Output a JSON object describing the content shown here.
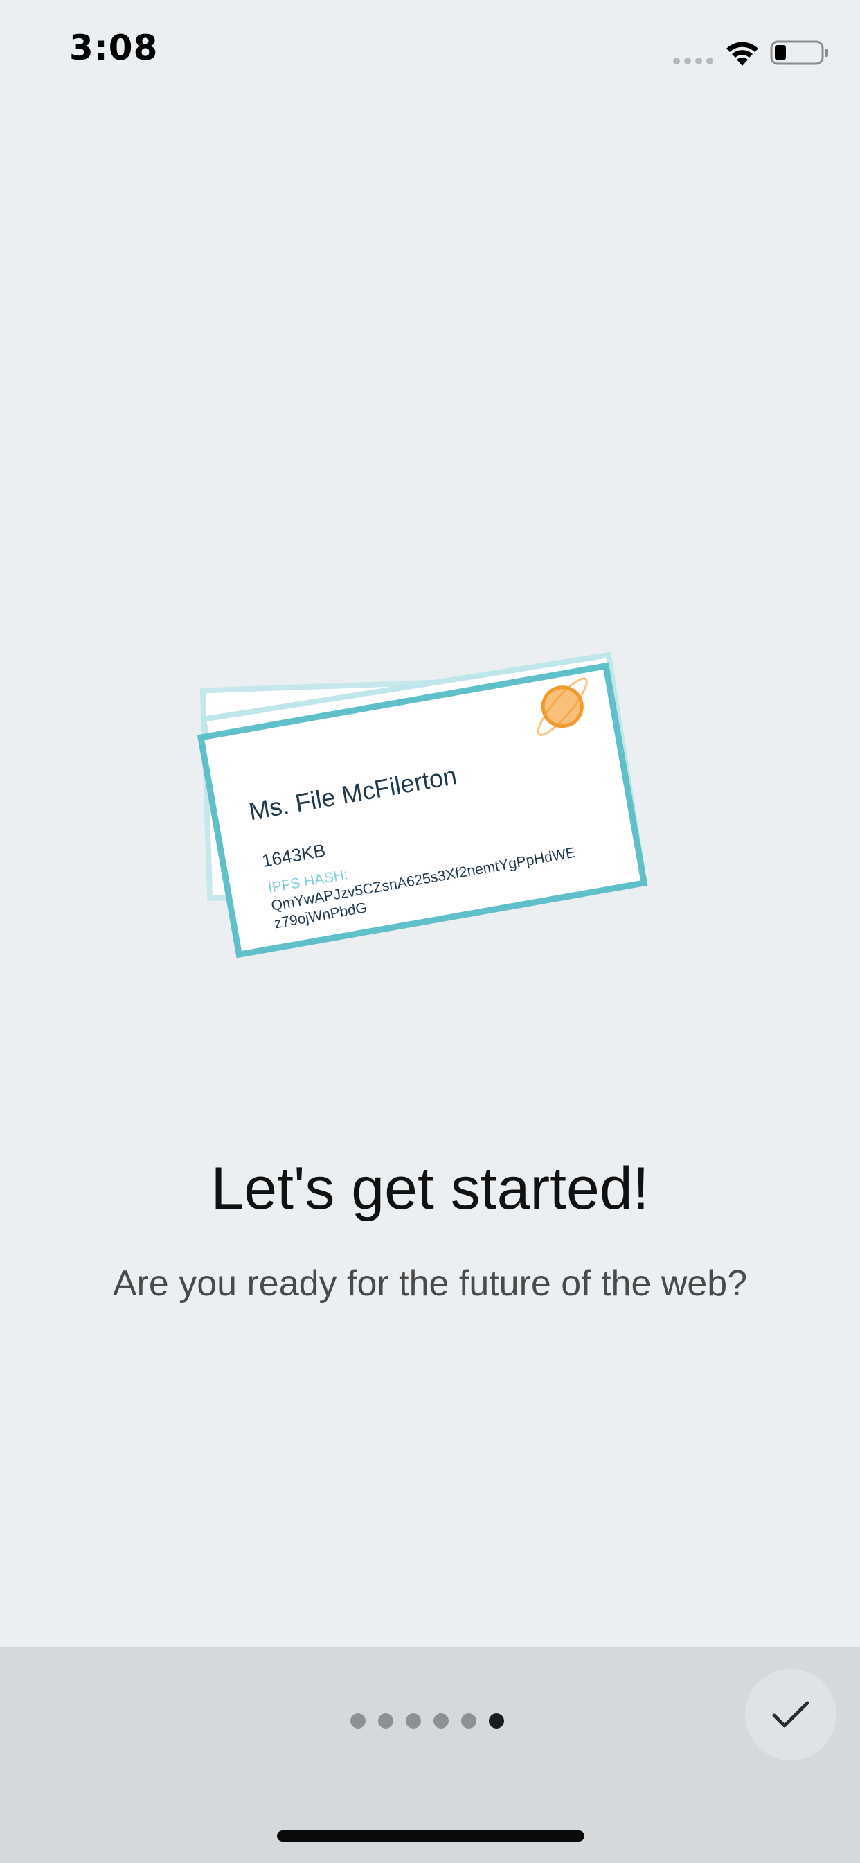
{
  "status_bar": {
    "time": "3:08",
    "signal_icon": "cellular-dots-icon",
    "wifi_icon": "wifi-icon",
    "battery_icon": "battery-icon",
    "battery_level": 0.25
  },
  "illustration": {
    "file_name": "Ms. File McFilerton",
    "file_size": "1643KB",
    "hash_label": "IPFS HASH:",
    "hash_line1": "QmYwAPJzv5CZsnA625s3Xf2nemtYgPpHdWE",
    "hash_line2": "z79ojWnPbdG",
    "planet_icon": "planet-icon",
    "colors": {
      "card_border": "#5fc0c9",
      "card_border_light": "#bfe6ea",
      "text_dark": "#1f3a4d",
      "hash_label": "#7fd0d8",
      "planet": "#f5a442"
    }
  },
  "headline": "Let's get started!",
  "subtitle": "Are you ready for the future of the web?",
  "pager": {
    "total_pages": 6,
    "current_page": 6
  },
  "done_button": {
    "icon": "checkmark-icon"
  }
}
